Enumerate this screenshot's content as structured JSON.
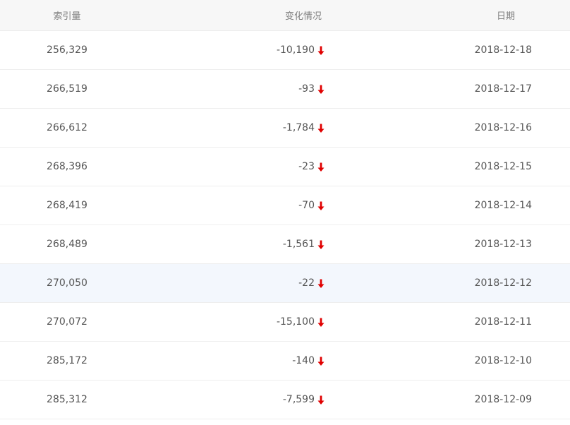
{
  "header": {
    "index_label": "索引量",
    "change_label": "变化情况",
    "date_label": "日期"
  },
  "colors": {
    "down_arrow": "#e00000",
    "header_bg": "#f7f7f7",
    "highlight_row_bg": "#f3f7fd"
  },
  "rows": [
    {
      "index": "256,329",
      "change": "-10,190",
      "direction": "down",
      "date": "2018-12-18"
    },
    {
      "index": "266,519",
      "change": "-93",
      "direction": "down",
      "date": "2018-12-17"
    },
    {
      "index": "266,612",
      "change": "-1,784",
      "direction": "down",
      "date": "2018-12-16"
    },
    {
      "index": "268,396",
      "change": "-23",
      "direction": "down",
      "date": "2018-12-15"
    },
    {
      "index": "268,419",
      "change": "-70",
      "direction": "down",
      "date": "2018-12-14"
    },
    {
      "index": "268,489",
      "change": "-1,561",
      "direction": "down",
      "date": "2018-12-13"
    },
    {
      "index": "270,050",
      "change": "-22",
      "direction": "down",
      "date": "2018-12-12"
    },
    {
      "index": "270,072",
      "change": "-15,100",
      "direction": "down",
      "date": "2018-12-11"
    },
    {
      "index": "285,172",
      "change": "-140",
      "direction": "down",
      "date": "2018-12-10"
    },
    {
      "index": "285,312",
      "change": "-7,599",
      "direction": "down",
      "date": "2018-12-09"
    }
  ]
}
